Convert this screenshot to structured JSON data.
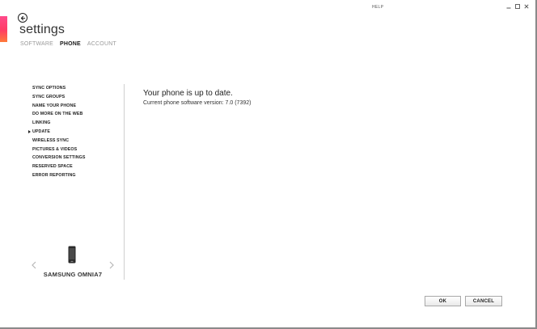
{
  "app": {
    "title": "settings",
    "help_label": "HELP",
    "accent_colors": [
      "#ff4b8b",
      "#ff3d64",
      "#ff7a3a"
    ]
  },
  "tabs": [
    {
      "label": "SOFTWARE",
      "active": false
    },
    {
      "label": "PHONE",
      "active": true
    },
    {
      "label": "ACCOUNT",
      "active": false
    }
  ],
  "sidebar": {
    "items": [
      {
        "label": "SYNC OPTIONS"
      },
      {
        "label": "SYNC GROUPS"
      },
      {
        "label": "NAME YOUR PHONE"
      },
      {
        "label": "DO MORE ON THE WEB"
      },
      {
        "label": "LINKING"
      },
      {
        "label": "UPDATE",
        "selected": true
      },
      {
        "label": "WIRELESS SYNC"
      },
      {
        "label": "PICTURES & VIDEOS"
      },
      {
        "label": "CONVERSION SETTINGS"
      },
      {
        "label": "RESERVED SPACE"
      },
      {
        "label": "ERROR REPORTING"
      }
    ]
  },
  "main": {
    "heading": "Your phone is up to date.",
    "subtext": "Current phone software version: 7.0 (7392)"
  },
  "device": {
    "name": "SAMSUNG OMNIA7",
    "icon": "phone-icon"
  },
  "buttons": {
    "ok_label": "OK",
    "cancel_label": "CANCEL"
  }
}
